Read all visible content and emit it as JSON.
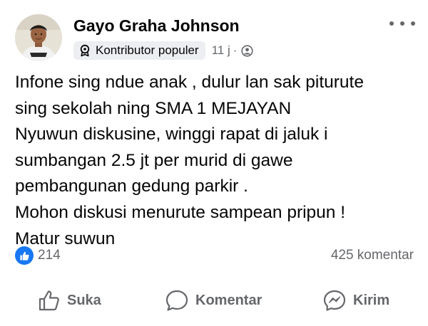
{
  "post": {
    "author": "Gayo Graha Johnson",
    "badge_label": "Kontributor populer",
    "time": "11 j",
    "separator": "·",
    "privacy_icon": "friends-globe-icon",
    "more_icon": "more-options-icon",
    "lines": [
      "Infone sing ndue anak , dulur lan sak piturute",
      "sing sekolah ning SMA 1 MEJAYAN",
      "Nyuwun diskusine, winggi rapat di jaluk i",
      "sumbangan 2.5 jt per murid di gawe",
      "pembangunan gedung parkir .",
      "Mohon diskusi menurute sampean pripun !",
      "Matur suwun"
    ]
  },
  "stats": {
    "likes": "214",
    "comments": "425 komentar",
    "like_color": "#1877f2"
  },
  "actions": {
    "like": "Suka",
    "comment": "Komentar",
    "send": "Kirim"
  }
}
